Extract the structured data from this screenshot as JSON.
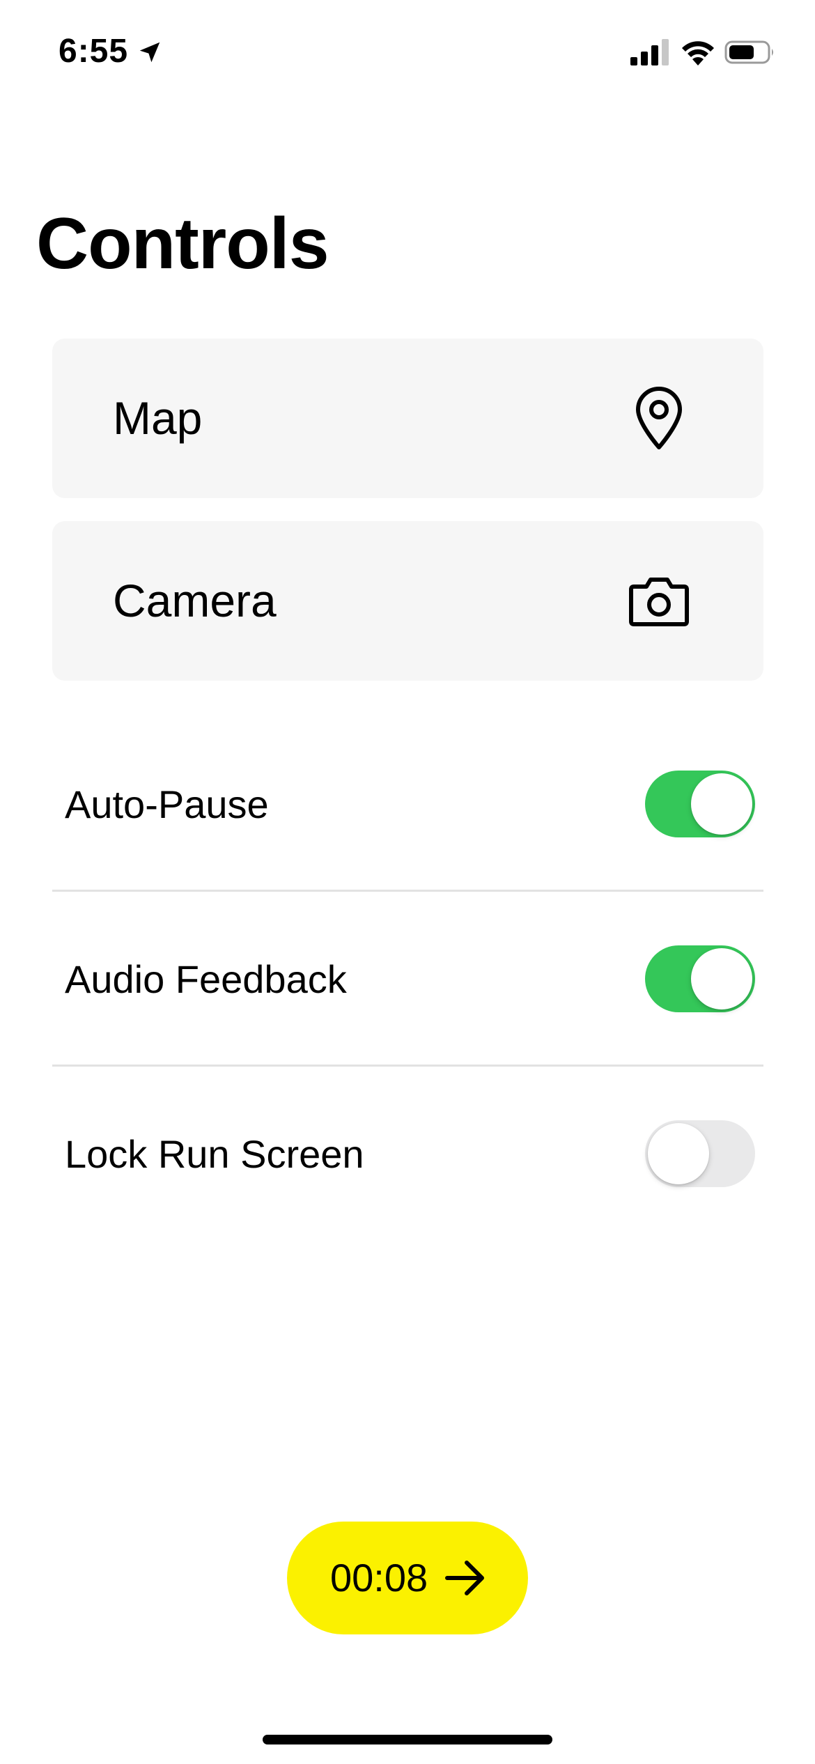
{
  "status_bar": {
    "time": "6:55",
    "location_icon": "location-arrow-icon",
    "signal_icon": "cellular-signal-icon",
    "wifi_icon": "wifi-icon",
    "battery_icon": "battery-icon"
  },
  "page": {
    "title": "Controls"
  },
  "cards": [
    {
      "label": "Map",
      "icon": "map-pin-icon"
    },
    {
      "label": "Camera",
      "icon": "camera-icon"
    }
  ],
  "toggles": [
    {
      "label": "Auto-Pause",
      "on": true
    },
    {
      "label": "Audio Feedback",
      "on": true
    },
    {
      "label": "Lock Run Screen",
      "on": false
    }
  ],
  "timer_button": {
    "time": "00:08",
    "icon": "arrow-right-icon"
  },
  "colors": {
    "toggle_on": "#34c759",
    "toggle_off": "#e9e9ea",
    "timer_button": "#fbf100",
    "card_background": "#f6f6f6"
  }
}
